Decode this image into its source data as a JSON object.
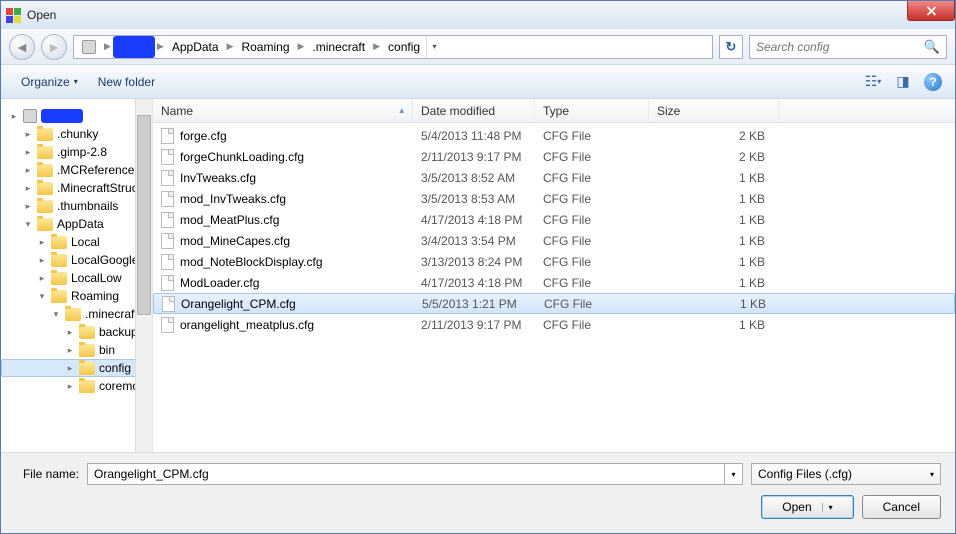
{
  "title": "Open",
  "breadcrumb": [
    "AppData",
    "Roaming",
    ".minecraft",
    "config"
  ],
  "search": {
    "placeholder": "Search config"
  },
  "toolbar": {
    "organize": "Organize",
    "newfolder": "New folder"
  },
  "columns": {
    "name": "Name",
    "date": "Date modified",
    "type": "Type",
    "size": "Size"
  },
  "files": [
    {
      "name": "forge.cfg",
      "date": "5/4/2013 11:48 PM",
      "type": "CFG File",
      "size": "2 KB",
      "sel": false
    },
    {
      "name": "forgeChunkLoading.cfg",
      "date": "2/11/2013 9:17 PM",
      "type": "CFG File",
      "size": "2 KB",
      "sel": false
    },
    {
      "name": "InvTweaks.cfg",
      "date": "3/5/2013 8:52 AM",
      "type": "CFG File",
      "size": "1 KB",
      "sel": false
    },
    {
      "name": "mod_InvTweaks.cfg",
      "date": "3/5/2013 8:53 AM",
      "type": "CFG File",
      "size": "1 KB",
      "sel": false
    },
    {
      "name": "mod_MeatPlus.cfg",
      "date": "4/17/2013 4:18 PM",
      "type": "CFG File",
      "size": "1 KB",
      "sel": false
    },
    {
      "name": "mod_MineCapes.cfg",
      "date": "3/4/2013 3:54 PM",
      "type": "CFG File",
      "size": "1 KB",
      "sel": false
    },
    {
      "name": "mod_NoteBlockDisplay.cfg",
      "date": "3/13/2013 8:24 PM",
      "type": "CFG File",
      "size": "1 KB",
      "sel": false
    },
    {
      "name": "ModLoader.cfg",
      "date": "4/17/2013 4:18 PM",
      "type": "CFG File",
      "size": "1 KB",
      "sel": false
    },
    {
      "name": "Orangelight_CPM.cfg",
      "date": "5/5/2013 1:21 PM",
      "type": "CFG File",
      "size": "1 KB",
      "sel": true
    },
    {
      "name": "orangelight_meatplus.cfg",
      "date": "2/11/2013 9:17 PM",
      "type": "CFG File",
      "size": "1 KB",
      "sel": false
    }
  ],
  "tree": [
    {
      "name": "",
      "indent": 0,
      "redact": true,
      "drive": true
    },
    {
      "name": ".chunky",
      "indent": 1
    },
    {
      "name": ".gimp-2.8",
      "indent": 1
    },
    {
      "name": ".MCReferenceS",
      "indent": 1
    },
    {
      "name": ".MinecraftStruc",
      "indent": 1
    },
    {
      "name": ".thumbnails",
      "indent": 1
    },
    {
      "name": "AppData",
      "indent": 1,
      "exp": true
    },
    {
      "name": "Local",
      "indent": 2
    },
    {
      "name": "LocalGoogle",
      "indent": 2
    },
    {
      "name": "LocalLow",
      "indent": 2
    },
    {
      "name": "Roaming",
      "indent": 2,
      "exp": true
    },
    {
      "name": ".minecraft",
      "indent": 3,
      "exp": true
    },
    {
      "name": "backups",
      "indent": 4
    },
    {
      "name": "bin",
      "indent": 4
    },
    {
      "name": "config",
      "indent": 4,
      "sel": true
    },
    {
      "name": "coremod",
      "indent": 4
    }
  ],
  "footer": {
    "filename_label": "File name:",
    "filename_value": "Orangelight_CPM.cfg",
    "filter": "Config Files (.cfg)",
    "open": "Open",
    "cancel": "Cancel"
  }
}
